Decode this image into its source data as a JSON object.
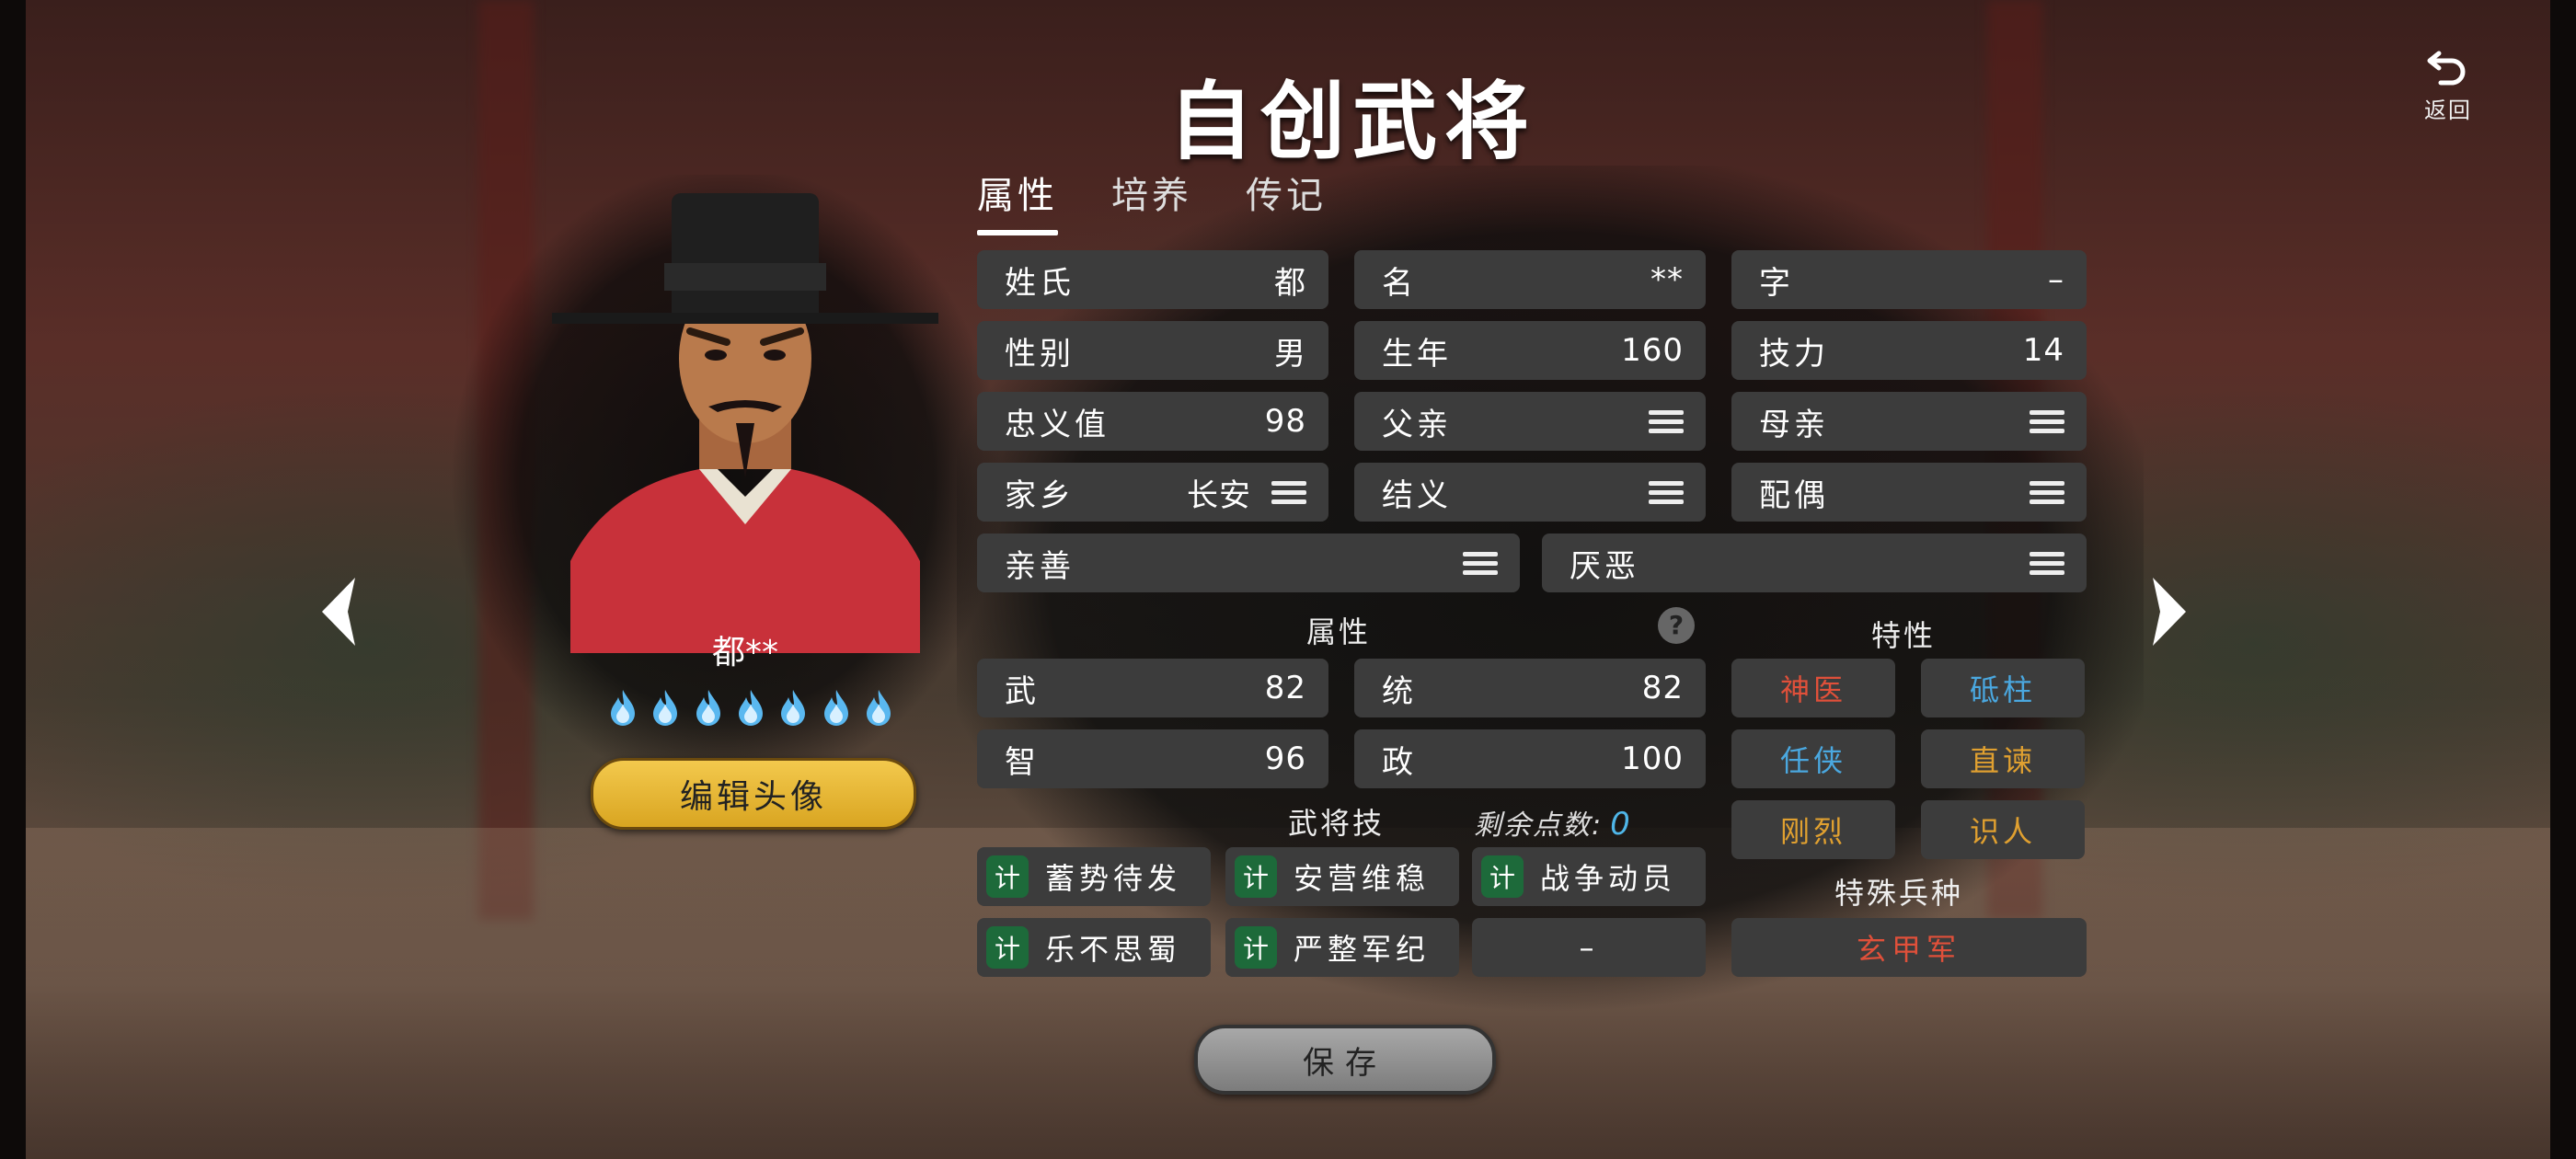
{
  "title": "自创武将",
  "back": {
    "label": "返回"
  },
  "tabs": [
    {
      "label": "属性",
      "active": true
    },
    {
      "label": "培养",
      "active": false
    },
    {
      "label": "传记",
      "active": false
    }
  ],
  "hero": {
    "name": "都**",
    "stars": 7,
    "edit_label": "编辑头像"
  },
  "fields": {
    "surname": {
      "label": "姓氏",
      "value": "都"
    },
    "given": {
      "label": "名",
      "value": "**"
    },
    "courtesy": {
      "label": "字",
      "value": "–"
    },
    "gender": {
      "label": "性别",
      "value": "男"
    },
    "birth": {
      "label": "生年",
      "value": "160"
    },
    "skill_power": {
      "label": "技力",
      "value": "14"
    },
    "loyalty": {
      "label": "忠义值",
      "value": "98"
    },
    "father": {
      "label": "父亲"
    },
    "mother": {
      "label": "母亲"
    },
    "hometown": {
      "label": "家乡",
      "value": "长安"
    },
    "sworn": {
      "label": "结义"
    },
    "spouse": {
      "label": "配偶"
    },
    "like": {
      "label": "亲善"
    },
    "dislike": {
      "label": "厌恶"
    }
  },
  "attributes": {
    "heading": "属性",
    "items": [
      {
        "label": "武",
        "value": "82"
      },
      {
        "label": "统",
        "value": "82"
      },
      {
        "label": "智",
        "value": "96"
      },
      {
        "label": "政",
        "value": "100"
      }
    ]
  },
  "traits": {
    "heading": "特性",
    "items": [
      {
        "label": "神医",
        "color": "#e0503a"
      },
      {
        "label": "砥柱",
        "color": "#4aa8e0"
      },
      {
        "label": "任侠",
        "color": "#4aa8e0"
      },
      {
        "label": "直谏",
        "color": "#e0a030"
      },
      {
        "label": "刚烈",
        "color": "#e0a030"
      },
      {
        "label": "识人",
        "color": "#e0a030"
      }
    ]
  },
  "skills": {
    "heading": "武将技",
    "remaining_label": "剩余点数:",
    "remaining_value": "0",
    "badge": "计",
    "items": [
      "蓄势待发",
      "安营维稳",
      "战争动员",
      "乐不思蜀",
      "严整军纪"
    ],
    "empty_label": "–"
  },
  "troop": {
    "heading": "特殊兵种",
    "value": "玄甲军"
  },
  "save_label": "保存",
  "colors": {
    "accent": "#f3c94d",
    "skill_badge": "#1d6a3a",
    "remaining": "#4fb6e8"
  }
}
